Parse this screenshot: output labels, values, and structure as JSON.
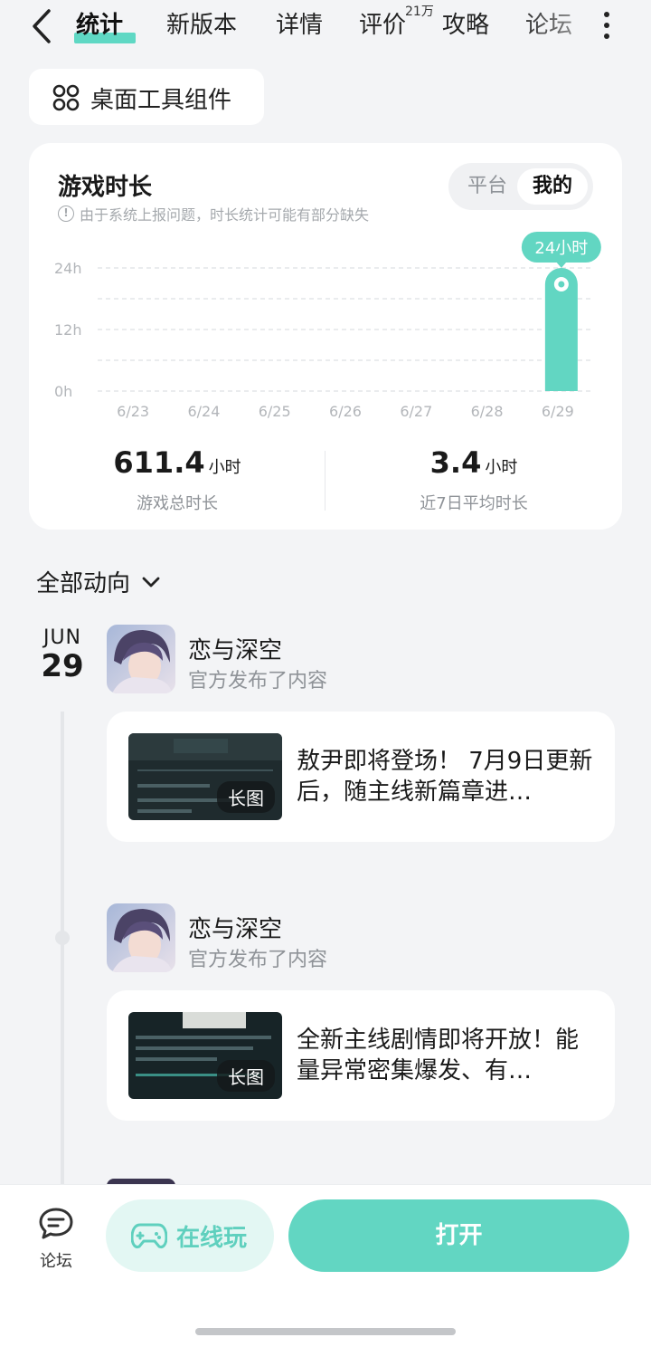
{
  "nav": {
    "tabs": [
      {
        "label": "统计"
      },
      {
        "label": "新版本"
      },
      {
        "label": "详情"
      },
      {
        "label": "评价",
        "badge": "21万"
      },
      {
        "label": "攻略"
      },
      {
        "label": "论坛"
      }
    ]
  },
  "widget_chip": {
    "label": "桌面工具组件"
  },
  "stats_card": {
    "title": "游戏时长",
    "notice": "由于系统上报问题，时长统计可能有部分缺失",
    "toggle": {
      "options": [
        "平台",
        "我的"
      ],
      "selected": "我的"
    },
    "totals": [
      {
        "value": "611.4",
        "unit": "小时",
        "caption": "游戏总时长"
      },
      {
        "value": "3.4",
        "unit": "小时",
        "caption": "近7日平均时长"
      }
    ]
  },
  "chart_data": {
    "type": "bar",
    "categories": [
      "6/23",
      "6/24",
      "6/25",
      "6/26",
      "6/27",
      "6/28",
      "6/29"
    ],
    "values": [
      0,
      0,
      0,
      0,
      0,
      0,
      24
    ],
    "ytick_labels": [
      "24h",
      "12h",
      "0h"
    ],
    "ylim": [
      0,
      24
    ],
    "highlight_label": "24小时",
    "grid": true,
    "color": "#62d6c2"
  },
  "feed": {
    "filter_label": "全部动向",
    "date": {
      "month": "JUN",
      "day": "29"
    },
    "posts": [
      {
        "author": "恋与深空",
        "action": "官方发布了内容",
        "badge": "长图",
        "text": "敖尹即将登场！ 7月9日更新后，随主线新篇章进…"
      },
      {
        "author": "恋与深空",
        "action": "官方发布了内容",
        "badge": "长图",
        "text": "全新主线剧情即将开放！能量异常密集爆发、有…"
      }
    ]
  },
  "bottom_bar": {
    "forum_label": "论坛",
    "cloud_play_label": "在线玩",
    "open_label": "打开"
  },
  "colors": {
    "accent": "#62d6c2",
    "accent_light": "#e3f7f3"
  }
}
